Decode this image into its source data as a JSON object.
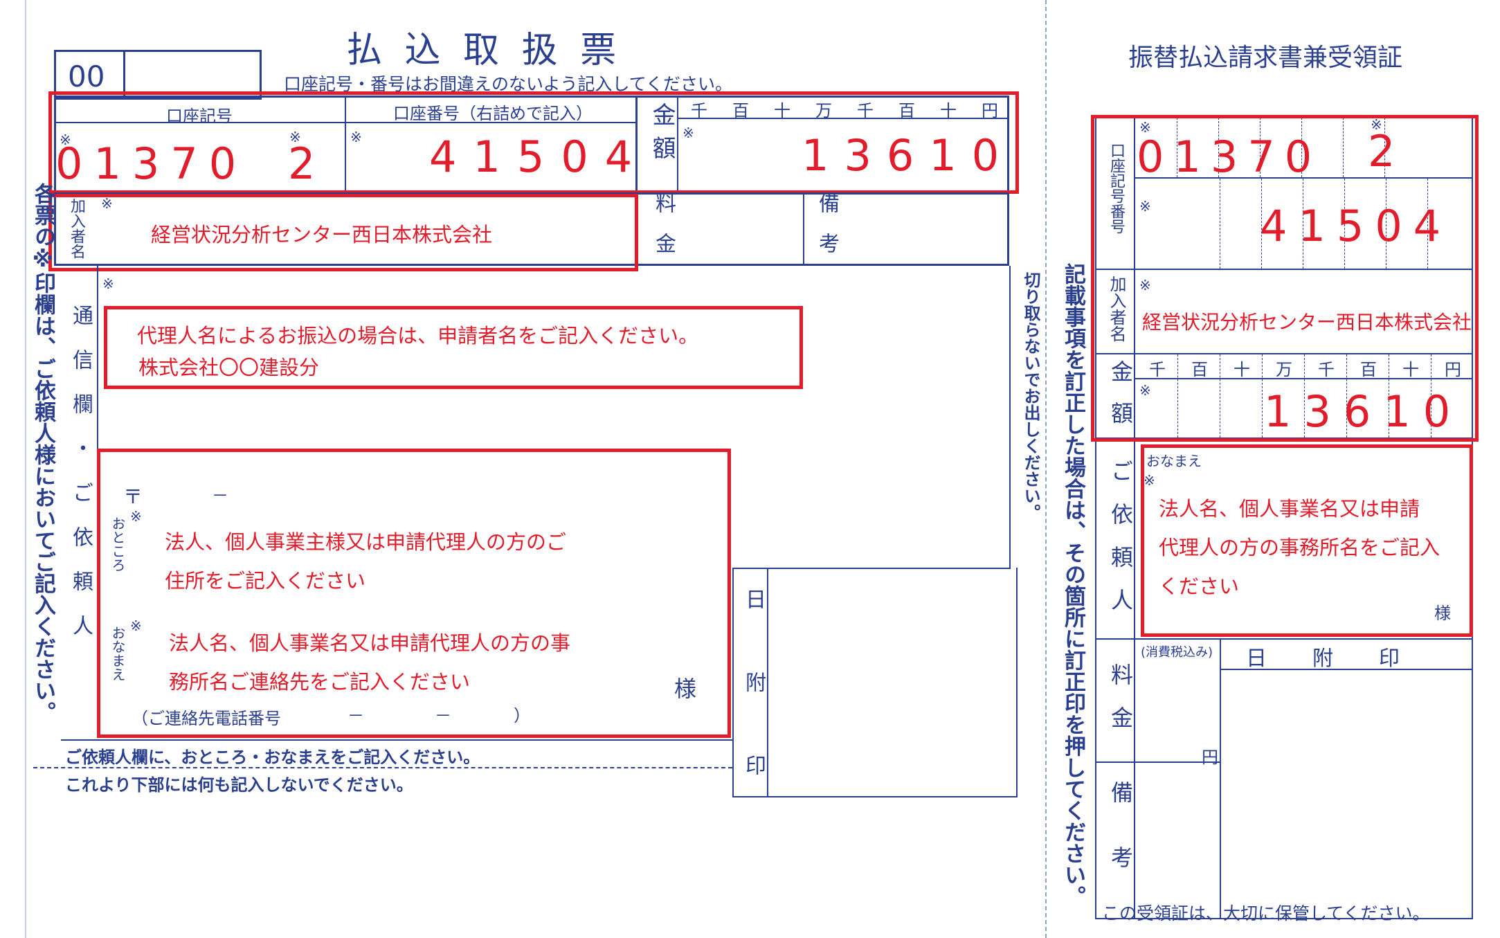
{
  "colors": {
    "form_blue": "#2b3f8f",
    "annotation_red": "#e21d2b"
  },
  "left": {
    "title": "払 込 取 扱 票",
    "subtitle": "口座記号・番号はお間違えのないよう記入してください。",
    "code_box": "00",
    "label_account_symbol": "口座記号",
    "label_account_number": "口座番号（右詰めで記入）",
    "label_amount": "金額",
    "amount_units": [
      "千",
      "百",
      "十",
      "万",
      "千",
      "百",
      "十",
      "円"
    ],
    "account_symbol_value": "01370",
    "account_symbol_sub": "2",
    "account_number_value": "41504",
    "amount_value": "13610",
    "label_subscriber": "加入者名",
    "subscriber_value": "経営状況分析センター西日本株式会社",
    "label_fee": "料金",
    "label_remarks": "備考",
    "label_comm": "通信欄・ご依頼人",
    "note_line1": "代理人名によるお振込の場合は、申請者名をご記入ください。",
    "note_line2": "株式会社〇〇建設分",
    "postal_mark": "〒",
    "postal_dash": "－",
    "label_address": "おところ",
    "address_line1": "法人、個人事業主様又は申請代理人の方のご",
    "address_line2": "住所をご記入ください",
    "label_name": "おなまえ",
    "name_line1": "法人名、個人事業名又は申請代理人の方の事",
    "name_line2": "務所名ご連絡先をご記入ください",
    "sama": "様",
    "phone_label": "（ご連絡先電話番号",
    "phone_dash1": "－",
    "phone_dash2": "－",
    "phone_close": "）",
    "footer1": "ご依頼人欄に、おところ・おなまえをご記入ください。",
    "footer2": "これより下部には何も記入しないでください。",
    "stamp_label": "日附印",
    "side_note": "各票の※印欄は、ご依頼人様においてご記入ください。"
  },
  "middle": {
    "cut_note": "切り取らないでお出しください。",
    "correction_note": "記載事項を訂正した場合は、その箇所に訂正印を押してください。"
  },
  "right": {
    "title": "振替払込請求書兼受領証",
    "label_account": "口座記号番号",
    "account_symbol_value": "01370",
    "account_symbol_sub": "2",
    "account_number_value": "41504",
    "label_subscriber": "加入者名",
    "subscriber_value": "経営状況分析センター西日本株式会社",
    "label_amount": "金額",
    "amount_units": [
      "千",
      "百",
      "十",
      "万",
      "千",
      "百",
      "十",
      "円"
    ],
    "amount_value": "13610",
    "label_requester": "ご依頼人",
    "label_name": "おなまえ",
    "name_line1": "法人名、個人事業名又は申請",
    "name_line2": "代理人の方の事務所名をご記入",
    "name_line3": "ください",
    "sama": "様",
    "label_fee": "料金",
    "fee_tax": "(消費税込み)",
    "fee_yen": "円",
    "label_remarks": "備考",
    "stamp_label": "日　附　印",
    "footer": "この受領証は、大切に保管してください。"
  }
}
